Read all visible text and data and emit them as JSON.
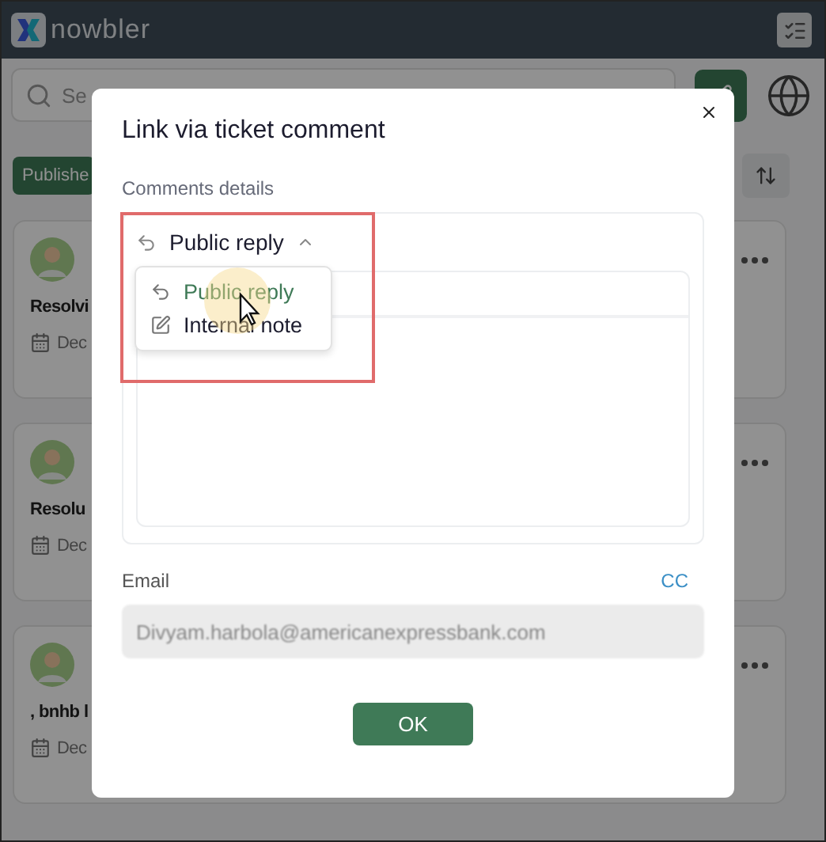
{
  "app": {
    "logo": "nowbler",
    "search": {
      "placeholder": "Se"
    },
    "tabs": [
      {
        "label": "Publishe",
        "selected": true
      }
    ],
    "cards": [
      {
        "title": "Resolvi",
        "date": "Dec"
      },
      {
        "title": "Resolu",
        "date": "Dec"
      },
      {
        "title": ", bnhb l",
        "date": "Dec"
      }
    ]
  },
  "dialog": {
    "title": "Link via ticket comment",
    "section_label": "Comments details",
    "reply_mode": {
      "label": "Public reply",
      "expanded": true
    },
    "menu": [
      {
        "label": "Public reply",
        "kind": "reply",
        "selected": true
      },
      {
        "label": "Internal note",
        "kind": "note",
        "selected": false
      }
    ],
    "email_label": "Email",
    "cc": "CC",
    "email": "Divyam.harbola@americanexpressbank.com",
    "ok": "OK"
  }
}
